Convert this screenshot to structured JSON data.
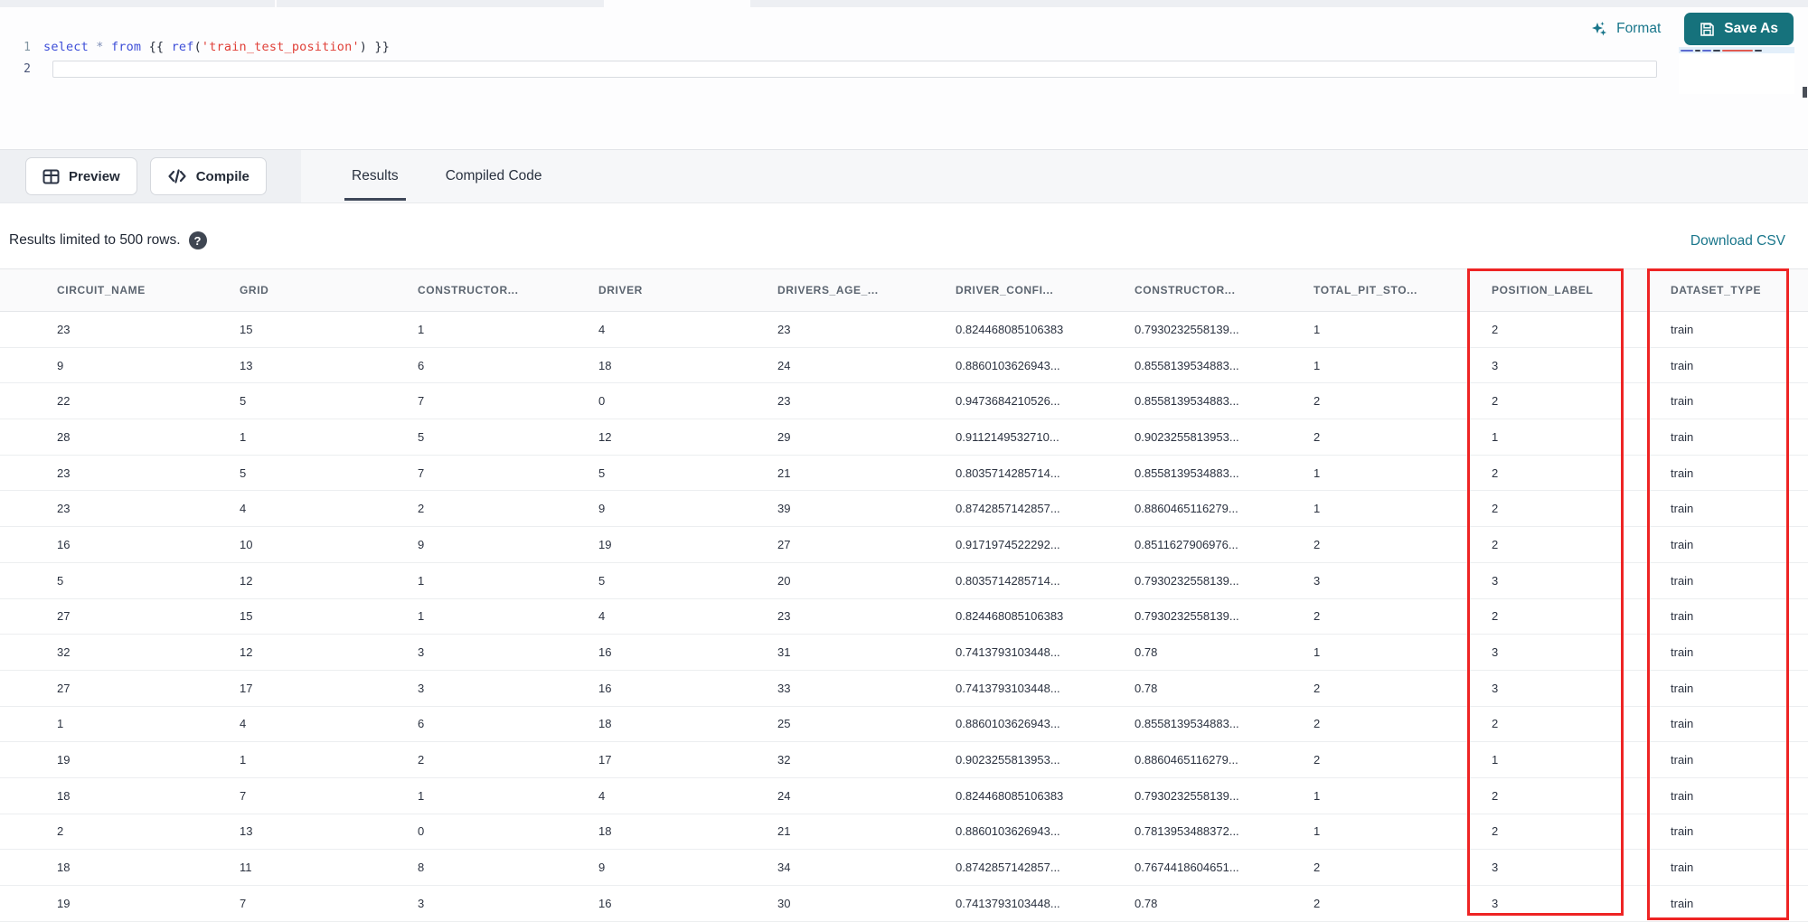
{
  "editor": {
    "line1_number": "1",
    "line2_number": "2",
    "code_tokens": [
      {
        "text": "select",
        "type": "kw"
      },
      {
        "text": " ",
        "type": "punct"
      },
      {
        "text": "*",
        "type": "op"
      },
      {
        "text": " ",
        "type": "punct"
      },
      {
        "text": "from",
        "type": "kw"
      },
      {
        "text": " {{ ",
        "type": "punct"
      },
      {
        "text": "ref",
        "type": "kw"
      },
      {
        "text": "(",
        "type": "punct"
      },
      {
        "text": "'train_test_position'",
        "type": "str"
      },
      {
        "text": ")",
        "type": "punct"
      },
      {
        "text": " }}",
        "type": "punct"
      }
    ],
    "format_label": "Format",
    "save_as_label": "Save As"
  },
  "toolbar": {
    "preview_label": "Preview",
    "compile_label": "Compile",
    "tabs": [
      {
        "label": "Results",
        "active": true
      },
      {
        "label": "Compiled Code",
        "active": false
      }
    ]
  },
  "results_bar": {
    "limit_text": "Results limited to 500 rows.",
    "help_glyph": "?",
    "download_label": "Download CSV"
  },
  "table": {
    "columns": [
      {
        "label": "CIRCUIT_NAME",
        "boxed": false
      },
      {
        "label": "GRID",
        "boxed": false
      },
      {
        "label": "CONSTRUCTOR...",
        "boxed": false
      },
      {
        "label": "DRIVER",
        "boxed": false
      },
      {
        "label": "DRIVERS_AGE_...",
        "boxed": false
      },
      {
        "label": "DRIVER_CONFI...",
        "boxed": false
      },
      {
        "label": "CONSTRUCTOR...",
        "boxed": false
      },
      {
        "label": "TOTAL_PIT_STO...",
        "boxed": false
      },
      {
        "label": "POSITION_LABEL",
        "boxed": true
      },
      {
        "label": "DATASET_TYPE",
        "boxed": true
      }
    ],
    "rows": [
      [
        "23",
        "15",
        "1",
        "4",
        "23",
        "0.824468085106383",
        "0.7930232558139...",
        "1",
        "2",
        "train"
      ],
      [
        "9",
        "13",
        "6",
        "18",
        "24",
        "0.8860103626943...",
        "0.8558139534883...",
        "1",
        "3",
        "train"
      ],
      [
        "22",
        "5",
        "7",
        "0",
        "23",
        "0.9473684210526...",
        "0.8558139534883...",
        "2",
        "2",
        "train"
      ],
      [
        "28",
        "1",
        "5",
        "12",
        "29",
        "0.9112149532710...",
        "0.9023255813953...",
        "2",
        "1",
        "train"
      ],
      [
        "23",
        "5",
        "7",
        "5",
        "21",
        "0.8035714285714...",
        "0.8558139534883...",
        "1",
        "2",
        "train"
      ],
      [
        "23",
        "4",
        "2",
        "9",
        "39",
        "0.8742857142857...",
        "0.8860465116279...",
        "1",
        "2",
        "train"
      ],
      [
        "16",
        "10",
        "9",
        "19",
        "27",
        "0.9171974522292...",
        "0.8511627906976...",
        "2",
        "2",
        "train"
      ],
      [
        "5",
        "12",
        "1",
        "5",
        "20",
        "0.8035714285714...",
        "0.7930232558139...",
        "3",
        "3",
        "train"
      ],
      [
        "27",
        "15",
        "1",
        "4",
        "23",
        "0.824468085106383",
        "0.7930232558139...",
        "2",
        "2",
        "train"
      ],
      [
        "32",
        "12",
        "3",
        "16",
        "31",
        "0.7413793103448...",
        "0.78",
        "1",
        "3",
        "train"
      ],
      [
        "27",
        "17",
        "3",
        "16",
        "33",
        "0.7413793103448...",
        "0.78",
        "2",
        "3",
        "train"
      ],
      [
        "1",
        "4",
        "6",
        "18",
        "25",
        "0.8860103626943...",
        "0.8558139534883...",
        "2",
        "2",
        "train"
      ],
      [
        "19",
        "1",
        "2",
        "17",
        "32",
        "0.9023255813953...",
        "0.8860465116279...",
        "2",
        "1",
        "train"
      ],
      [
        "18",
        "7",
        "1",
        "4",
        "24",
        "0.824468085106383",
        "0.7930232558139...",
        "1",
        "2",
        "train"
      ],
      [
        "2",
        "13",
        "0",
        "18",
        "21",
        "0.8860103626943...",
        "0.7813953488372...",
        "1",
        "2",
        "train"
      ],
      [
        "18",
        "11",
        "8",
        "9",
        "34",
        "0.8742857142857...",
        "0.7674418604651...",
        "2",
        "3",
        "train"
      ],
      [
        "19",
        "7",
        "3",
        "16",
        "30",
        "0.7413793103448...",
        "0.78",
        "2",
        "3",
        "train"
      ]
    ]
  },
  "colors": {
    "accent_teal": "#16727c",
    "link_teal": "#19768b",
    "highlight_red": "#ee2424",
    "tab_underline": "#3e4759"
  }
}
